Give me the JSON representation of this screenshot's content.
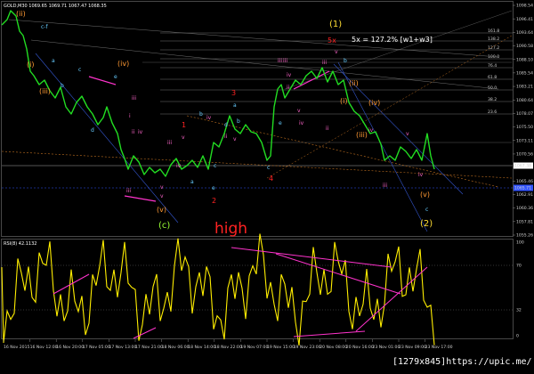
{
  "price_panel": {
    "header": "GOLD,M30  1069.65 1069.71 1067.47 1068.35",
    "wave_labels": [
      {
        "text": "(ii)",
        "color": "#ff9933"
      },
      {
        "text": "c-f",
        "color": "#66ccff"
      },
      {
        "text": "(i)",
        "color": "#ff9933"
      },
      {
        "text": "(iii)",
        "color": "#ff9933"
      },
      {
        "text": "a",
        "color": "#66ccff"
      },
      {
        "text": "b",
        "color": "#66ccff"
      },
      {
        "text": "c",
        "color": "#66ccff"
      },
      {
        "text": "d",
        "color": "#66ccff"
      },
      {
        "text": "e",
        "color": "#66ccff"
      },
      {
        "text": "(iv)",
        "color": "#ff9933"
      },
      {
        "text": "i",
        "color": "#ff66cc"
      },
      {
        "text": "ii",
        "color": "#ff66cc"
      },
      {
        "text": "iii",
        "color": "#ff66cc"
      },
      {
        "text": "iv",
        "color": "#ff66cc"
      },
      {
        "text": "v",
        "color": "#ff66cc"
      },
      {
        "text": "iii",
        "color": "#ff66cc"
      },
      {
        "text": "v",
        "color": "#ff66cc"
      },
      {
        "text": "(c)",
        "color": "#99ff33"
      },
      {
        "text": "(v)",
        "color": "#ff9933"
      },
      {
        "text": "iii",
        "color": "#ff66cc"
      },
      {
        "text": "iv",
        "color": "#ff66cc"
      },
      {
        "text": "v",
        "color": "#ff66cc"
      },
      {
        "text": "a",
        "color": "#66ccff"
      },
      {
        "text": "b",
        "color": "#66ccff"
      },
      {
        "text": "c",
        "color": "#66ccff"
      },
      {
        "text": "e",
        "color": "#66ccff"
      },
      {
        "text": "d",
        "color": "#66ccff"
      },
      {
        "text": "ii",
        "color": "#ff66cc"
      },
      {
        "text": "iv",
        "color": "#ff66cc"
      },
      {
        "text": "1",
        "color": "#ff2222"
      },
      {
        "text": "2",
        "color": "#ff2222"
      },
      {
        "text": "3",
        "color": "#ff2222"
      },
      {
        "text": "4",
        "color": "#ff2222"
      },
      {
        "text": "a",
        "color": "#66ccff"
      },
      {
        "text": "b",
        "color": "#66ccff"
      },
      {
        "text": "c",
        "color": "#66ccff"
      },
      {
        "text": "e",
        "color": "#66ccff"
      },
      {
        "text": "iii",
        "color": "#ff66cc"
      },
      {
        "text": "v",
        "color": "#ff66cc"
      },
      {
        "text": "iii",
        "color": "#ff66cc"
      },
      {
        "text": "iv",
        "color": "#ff66cc"
      },
      {
        "text": "v",
        "color": "#ff66cc"
      },
      {
        "text": "ii",
        "color": "#ff66cc"
      },
      {
        "text": "iv",
        "color": "#ff66cc"
      },
      {
        "text": "(1)",
        "color": "#ffdd33"
      },
      {
        "text": "5x",
        "color": "#ff2222"
      },
      {
        "text": "5x = 127.2% [w1+w3]",
        "color": "#ffffff"
      },
      {
        "text": "iii",
        "color": "#ff66cc"
      },
      {
        "text": "v",
        "color": "#ff66cc"
      },
      {
        "text": "b",
        "color": "#66ccff"
      },
      {
        "text": "(ii)",
        "color": "#ff9933"
      },
      {
        "text": "(i)",
        "color": "#ff9933"
      },
      {
        "text": "(iv)",
        "color": "#ff9933"
      },
      {
        "text": "(iii)",
        "color": "#ff9933"
      },
      {
        "text": "ii",
        "color": "#ff66cc"
      },
      {
        "text": "iv",
        "color": "#ff66cc"
      },
      {
        "text": "iii",
        "color": "#ff66cc"
      },
      {
        "text": "v",
        "color": "#ff66cc"
      },
      {
        "text": "iv",
        "color": "#ff66cc"
      },
      {
        "text": "(v)",
        "color": "#ff9933"
      },
      {
        "text": "c",
        "color": "#66ccff"
      },
      {
        "text": "(2)",
        "color": "#ffdd33"
      }
    ],
    "high_label": {
      "text": "high",
      "color": "#ff2222"
    },
    "price_axis": [
      "1098.54",
      "1096.41",
      "1093.64",
      "1090.58",
      "1088.10",
      "1085.54",
      "1083.21",
      "1080.64",
      "1078.07",
      "1075.50",
      "1073.11",
      "1070.56",
      "1068.01",
      "1065.46",
      "1062.91",
      "1060.36",
      "1057.81",
      "1055.26"
    ],
    "current_price": "1067.38",
    "current_price2": "1065.71",
    "fib_labels": [
      "161.8",
      "138.2",
      "127.2",
      "100.0",
      "76.4",
      "61.8",
      "50.0",
      "38.2",
      "23.6"
    ]
  },
  "rsi_panel": {
    "header": "RSI(8) 42.1132",
    "levels": [
      "100",
      "70",
      "32",
      "0"
    ]
  },
  "time_axis": [
    "16 Nov 2015",
    "16 Nov 12:00",
    "16 Nov 20:00",
    "17 Nov 05:00",
    "17 Nov 13:00",
    "17 Nov 21:00",
    "18 Nov 06:00",
    "18 Nov 14:00",
    "18 Nov 22:00",
    "19 Nov 07:00",
    "19 Nov 15:00",
    "19 Nov 23:00",
    "20 Nov 08:00",
    "20 Nov 16:00",
    "23 Nov 01:00",
    "23 Nov 09:00",
    "23 Nov 17:00"
  ],
  "watermark": "[1279x845]https://upic.me/"
}
